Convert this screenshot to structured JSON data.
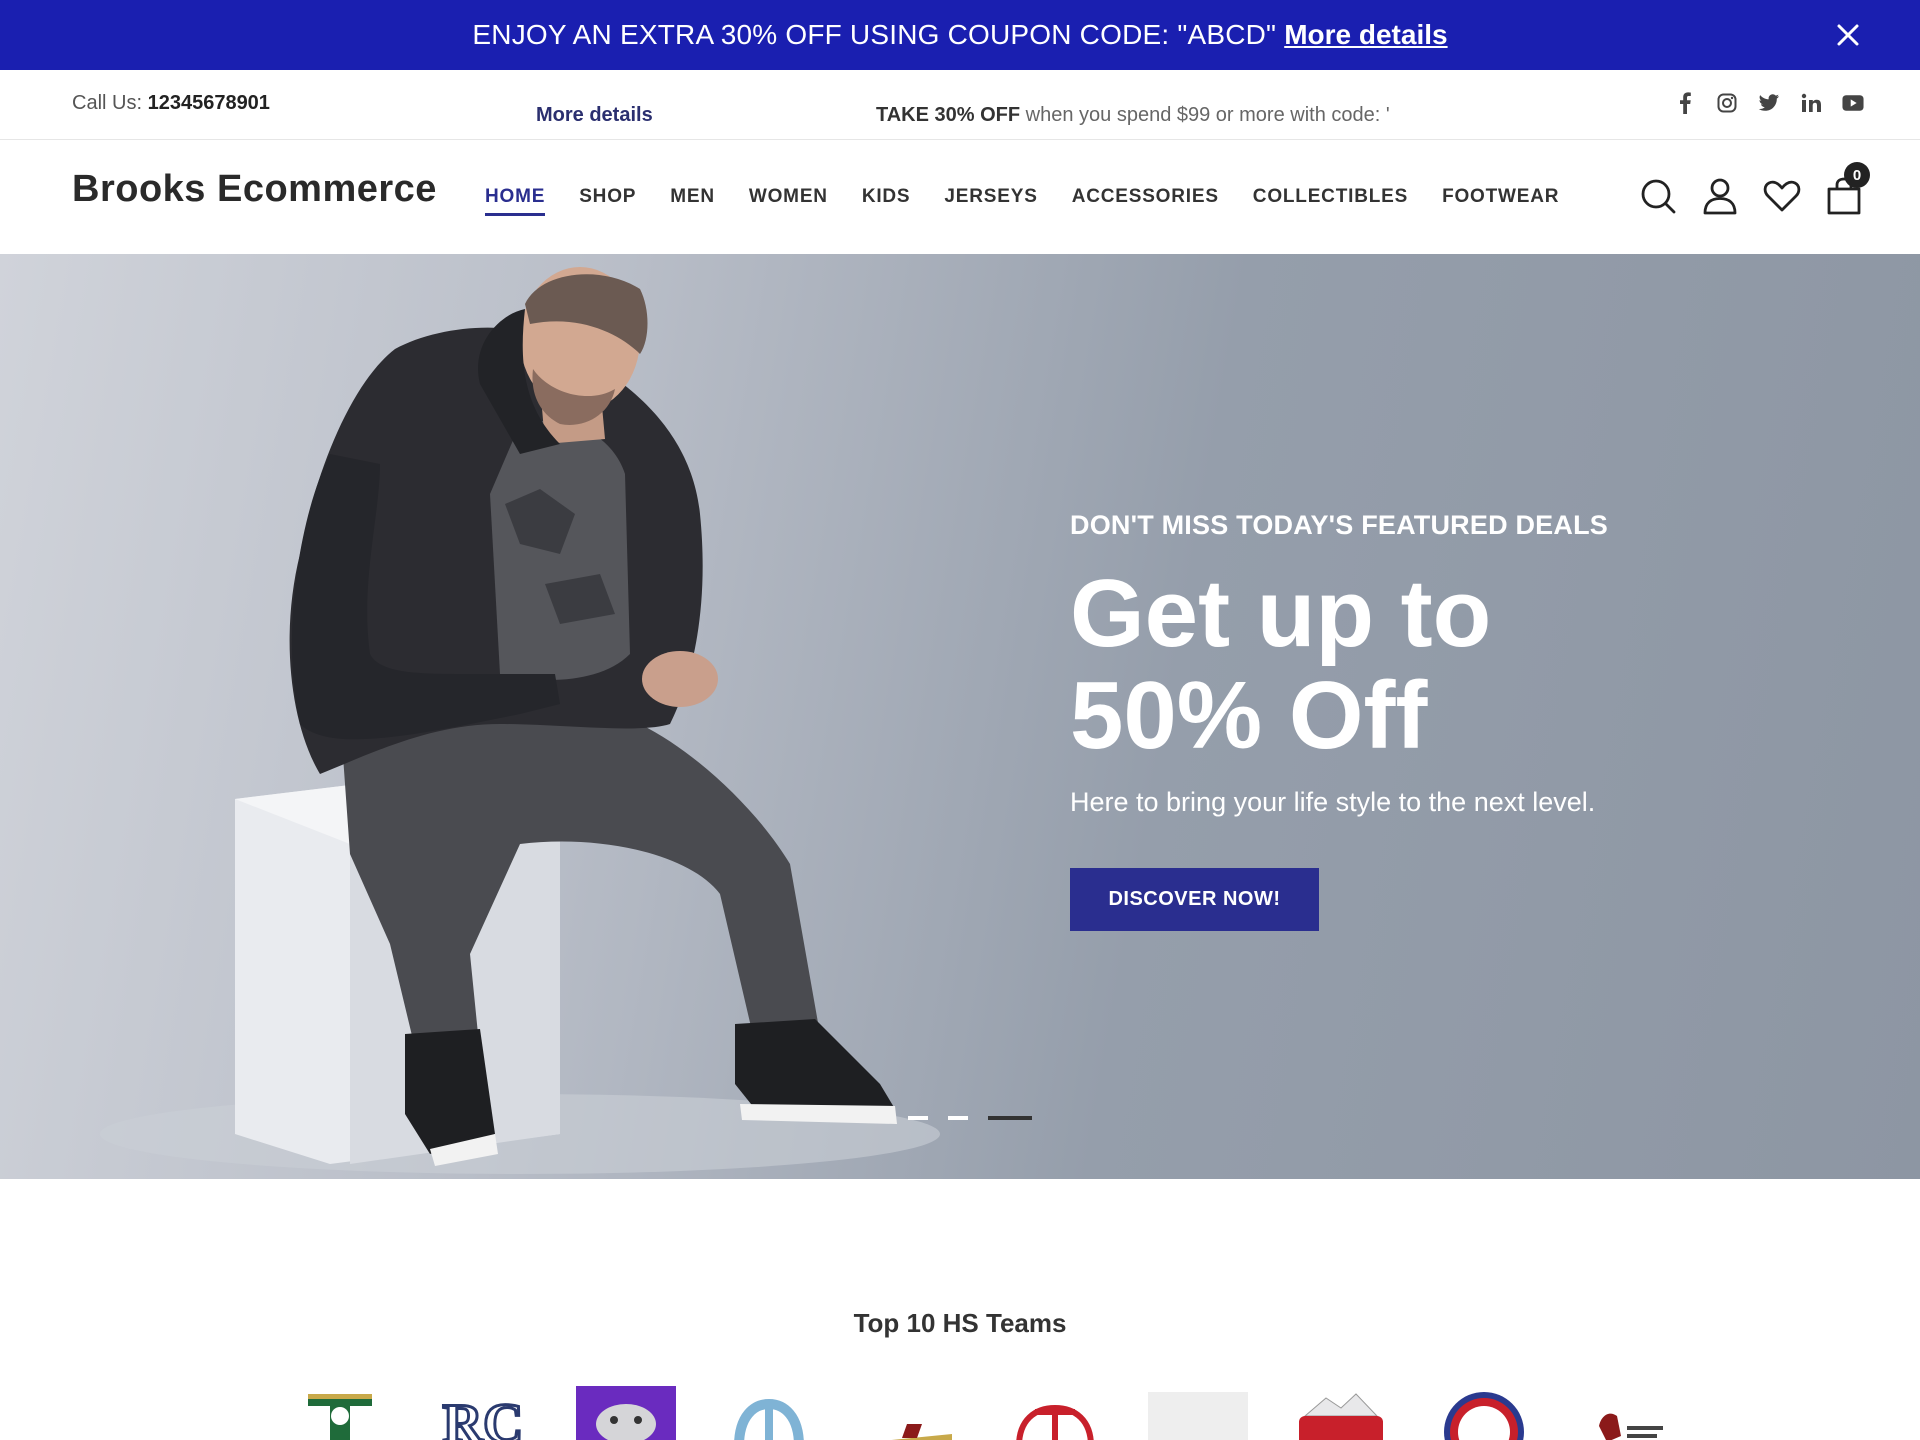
{
  "promo": {
    "text": "ENJOY AN EXTRA 30% OFF USING COUPON CODE: \"ABCD\"",
    "link": "More details",
    "close_icon": "close-icon"
  },
  "topbar": {
    "call_label": "Call Us:",
    "phone": "12345678901",
    "ticker_link": "More details",
    "ticker_offer_bold": "TAKE 30% OFF",
    "ticker_offer_rest": " when you spend $99 or more with code: '",
    "socials": [
      "facebook-icon",
      "instagram-icon",
      "twitter-icon",
      "linkedin-icon",
      "youtube-icon"
    ]
  },
  "header": {
    "brand": "Brooks Ecommerce",
    "nav": [
      "HOME",
      "SHOP",
      "MEN",
      "WOMEN",
      "KIDS",
      "JERSEYS",
      "ACCESSORIES",
      "COLLECTIBLES",
      "FOOTWEAR"
    ],
    "active_nav": "HOME",
    "cart_count": "0",
    "icons": [
      "search-icon",
      "user-icon",
      "heart-icon",
      "bag-icon"
    ]
  },
  "hero": {
    "eyebrow": "DON'T MISS TODAY'S FEATURED DEALS",
    "title_line1": "Get up to",
    "title_line2": "50% Off",
    "subtitle": "Here to bring your life style to the next level.",
    "cta": "DISCOVER NOW!",
    "slides_total": 3,
    "active_slide": 3
  },
  "teams": {
    "title": "Top 10 HS Teams",
    "logos": [
      "team-logo-1",
      "team-logo-2",
      "team-logo-3",
      "team-logo-4",
      "team-logo-5",
      "team-logo-6",
      "team-logo-7",
      "team-logo-8",
      "team-logo-9",
      "team-logo-10"
    ]
  },
  "colors": {
    "promo_bg": "#1a1fb0",
    "accent": "#2a2e8f"
  }
}
